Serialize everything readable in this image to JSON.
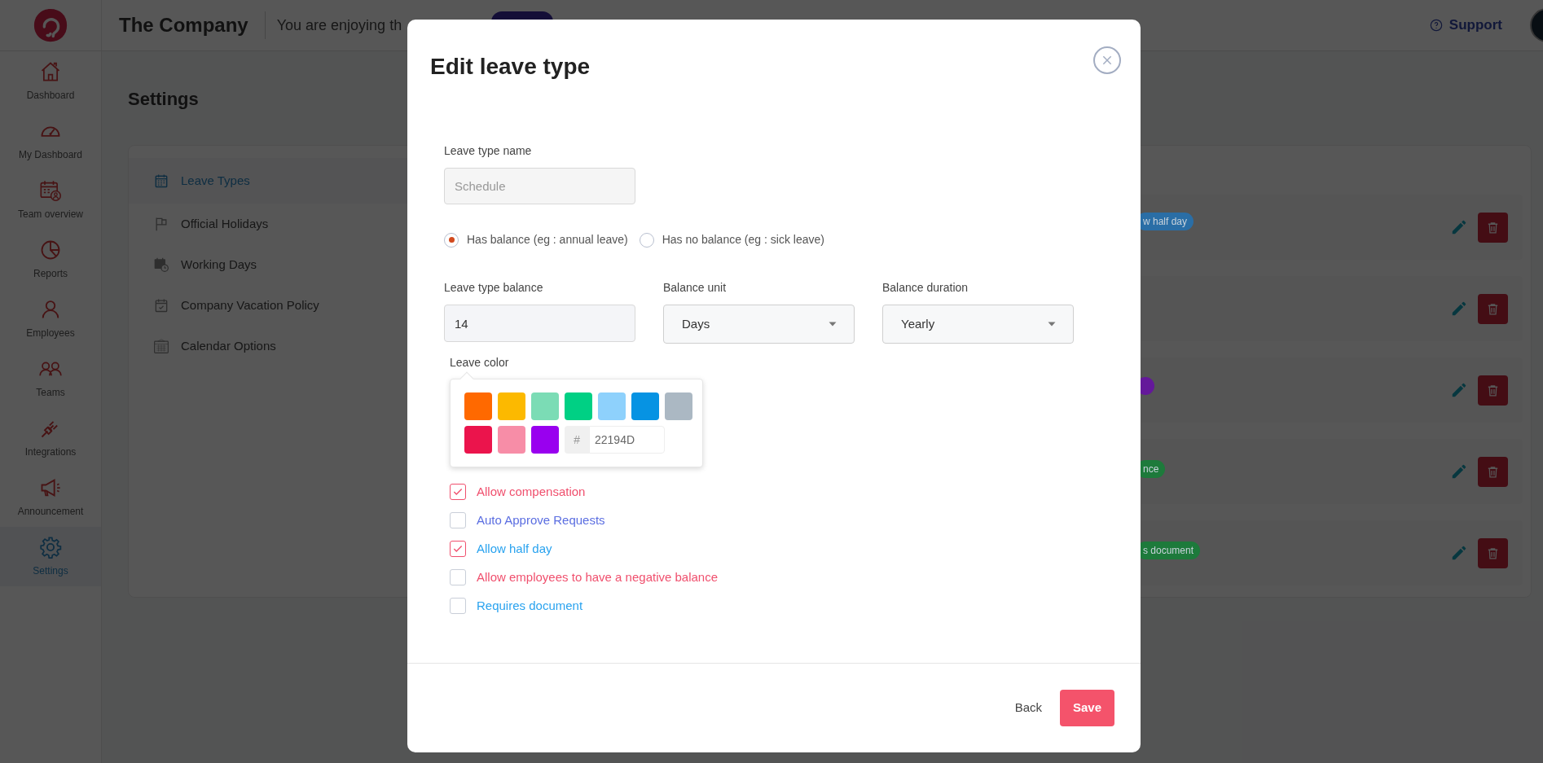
{
  "header": {
    "company": "The Company",
    "notice": "You are enjoying th",
    "support": "Support"
  },
  "sidebar": {
    "items": [
      {
        "label": "Dashboard",
        "kind": "home",
        "selected": false
      },
      {
        "label": "My Dashboard",
        "kind": "gauge",
        "selected": false
      },
      {
        "label": "Team overview",
        "kind": "calendar-person",
        "selected": false
      },
      {
        "label": "Reports",
        "kind": "pie",
        "selected": false
      },
      {
        "label": "Employees",
        "kind": "person",
        "selected": false
      },
      {
        "label": "Teams",
        "kind": "people",
        "selected": false
      },
      {
        "label": "Integrations",
        "kind": "plug",
        "selected": false
      },
      {
        "label": "Announcement",
        "kind": "megaphone",
        "selected": false
      },
      {
        "label": "Settings",
        "kind": "gear",
        "selected": true
      }
    ]
  },
  "page_title": "Settings",
  "settings_menu": [
    {
      "label": "Leave Types",
      "kind": "calendar",
      "selected": true
    },
    {
      "label": "Official Holidays",
      "kind": "flag",
      "selected": false
    },
    {
      "label": "Working Days",
      "kind": "calendar-clock",
      "selected": false
    },
    {
      "label": "Company Vacation Policy",
      "kind": "calendar-check",
      "selected": false
    },
    {
      "label": "Calendar Options",
      "kind": "calendar-grid",
      "selected": false
    }
  ],
  "leave_rows": [
    {
      "tag": {
        "text": "w half day",
        "color": "#2a6ea6"
      }
    },
    {},
    {
      "tag": {
        "color": "#64189a"
      }
    },
    {
      "tag": {
        "text": "nce",
        "color": "#1d7a3b"
      }
    },
    {
      "tag": {
        "text": "s document",
        "color": "#1d7a3b"
      }
    }
  ],
  "modal": {
    "title": "Edit leave type",
    "name_label": "Leave type name",
    "name_value": "Schedule",
    "name_disabled": true,
    "balance_options": [
      {
        "label": "Has balance (eg : annual leave)",
        "selected": true
      },
      {
        "label": "Has no balance (eg : sick leave)",
        "selected": false
      }
    ],
    "fields": [
      {
        "label": "Leave type balance",
        "value": "14",
        "kind": "input"
      },
      {
        "label": "Balance unit",
        "value": "Days",
        "kind": "select"
      },
      {
        "label": "Balance duration",
        "value": "Yearly",
        "kind": "select"
      }
    ],
    "color_label": "Leave color",
    "swatches": [
      {
        "color": "#ff6900"
      },
      {
        "color": "#fcb900"
      },
      {
        "color": "#7bdcb5"
      },
      {
        "color": "#00d084"
      },
      {
        "color": "#8ed1fc"
      },
      {
        "color": "#0693e3"
      },
      {
        "color": "#abb8c3"
      },
      {
        "color": "#eb144c"
      },
      {
        "color": "#f78da7"
      },
      {
        "color": "#9900ef"
      }
    ],
    "hex_prefix": "#",
    "hex_value": "22194D",
    "options": [
      {
        "label": "Allow compensation",
        "checked": true,
        "color": "#f0506e"
      },
      {
        "label": "Auto Approve Requests",
        "checked": false,
        "color": "#5b6ee1"
      },
      {
        "label": "Allow half day",
        "checked": true,
        "color": "#2aa3ef"
      },
      {
        "label": "Allow employees to have a negative balance",
        "checked": false,
        "color": "#f0506e"
      },
      {
        "label": "Requires document",
        "checked": false,
        "color": "#2aa3ef"
      }
    ],
    "back": "Back",
    "save": "Save"
  }
}
